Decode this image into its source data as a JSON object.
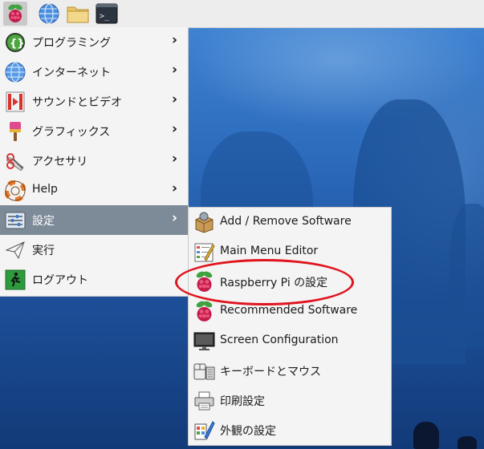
{
  "taskbar": {
    "icons": [
      "raspberry-menu-icon",
      "web-browser-icon",
      "file-manager-icon",
      "terminal-icon"
    ]
  },
  "main_menu": {
    "items": [
      {
        "label": "プログラミング",
        "icon": "programming-icon",
        "has_submenu": true
      },
      {
        "label": "インターネット",
        "icon": "internet-globe-icon",
        "has_submenu": true
      },
      {
        "label": "サウンドとビデオ",
        "icon": "sound-video-icon",
        "has_submenu": true
      },
      {
        "label": "グラフィックス",
        "icon": "graphics-brush-icon",
        "has_submenu": true
      },
      {
        "label": "アクセサリ",
        "icon": "accessories-icon",
        "has_submenu": true
      },
      {
        "label": "Help",
        "icon": "help-lifebuoy-icon",
        "has_submenu": true
      },
      {
        "label": "設定",
        "icon": "settings-icon",
        "has_submenu": true,
        "active": true
      },
      {
        "label": "実行",
        "icon": "run-paperplane-icon",
        "has_submenu": false
      },
      {
        "label": "ログアウト",
        "icon": "logout-icon",
        "has_submenu": false
      }
    ],
    "submenu_arrow": "›"
  },
  "settings_submenu": {
    "items": [
      {
        "label": "Add / Remove Software",
        "icon": "package-icon"
      },
      {
        "label": "Main Menu Editor",
        "icon": "menu-editor-icon"
      },
      {
        "label": "Raspberry Pi の設定",
        "icon": "raspberry-icon",
        "highlighted": true
      },
      {
        "label": "Recommended Software",
        "icon": "raspberry-icon"
      },
      {
        "label": "Screen Configuration",
        "icon": "monitor-icon"
      },
      {
        "label": "キーボードとマウス",
        "icon": "keyboard-mouse-icon"
      },
      {
        "label": "印刷設定",
        "icon": "printer-icon"
      },
      {
        "label": "外観の設定",
        "icon": "appearance-icon"
      }
    ]
  },
  "colors": {
    "menu_bg": "#f4f4f4",
    "active_bg": "#7d8a97",
    "highlight_ring": "#e0141e",
    "desktop_blue": "#2a67b8"
  }
}
